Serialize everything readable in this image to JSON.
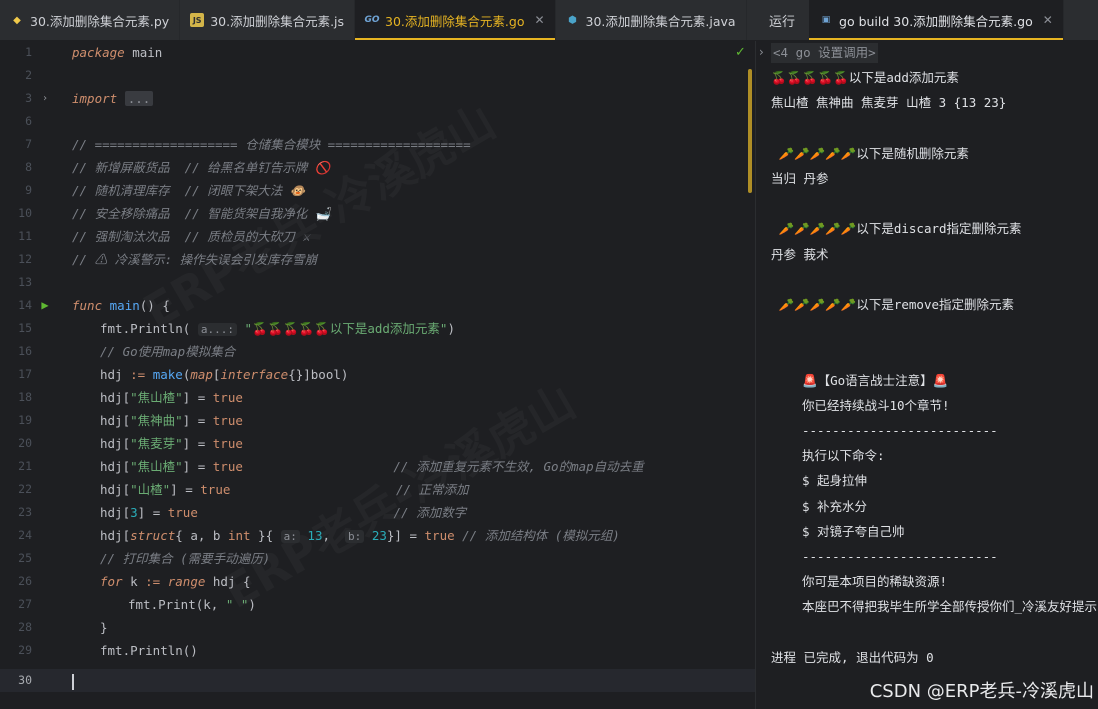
{
  "editor_tabs": [
    {
      "label": "30.添加删除集合元素.py",
      "icon": "python-icon"
    },
    {
      "label": "30.添加删除集合元素.js",
      "icon": "js-icon"
    },
    {
      "label": "30.添加删除集合元素.go",
      "icon": "go-icon",
      "active": true
    },
    {
      "label": "30.添加删除集合元素.java",
      "icon": "java-icon"
    }
  ],
  "more_label": "⋮",
  "run_panel": {
    "title": "运行",
    "tab_label": "go build 30.添加删除集合元素.go"
  },
  "code": {
    "l1_kw": "package",
    "l1_rest": " main",
    "l3_kw": "import",
    "l3_fold": "...",
    "l7": "// =================== 仓储集合模块 ===================",
    "l8": "// 新增屏蔽货品  // 给黑名单钉告示牌 🚫",
    "l9": "// 随机清理库存  // 闭眼下架大法 🐵",
    "l10": "// 安全移除痛品  // 智能货架自我净化 🛁",
    "l11": "// 强制淘汰次品  // 质检员的大砍刀 ⚔",
    "l12": "// ⚠ 冷溪警示: 操作失误会引发库存雪崩",
    "l14_kw": "func",
    "l14_fn": "main",
    "l14_rest": "() {",
    "l15_a": "fmt.Println( ",
    "l15_hint": "a...:",
    "l15_str": "\"🍒🍒🍒🍒🍒以下是add添加元素\"",
    "l15_end": ")",
    "l16": "// Go使用map模拟集合",
    "l17_a": "hdj ",
    "l17_op": ":=",
    "l17_fn": " make",
    "l17_p": "(",
    "l17_kw": "map",
    "l17_b": "[",
    "l17_kw2": "interface",
    "l17_c": "{}]",
    "l17_t": "bool",
    "l17_d": ")",
    "l18_a": "hdj[",
    "l18_s": "\"焦山楂\"",
    "l18_b": "] = ",
    "l18_v": "true",
    "l19_a": "hdj[",
    "l19_s": "\"焦神曲\"",
    "l19_b": "] = ",
    "l19_v": "true",
    "l20_a": "hdj[",
    "l20_s": "\"焦麦芽\"",
    "l20_b": "] = ",
    "l20_v": "true",
    "l21_a": "hdj[",
    "l21_s": "\"焦山楂\"",
    "l21_b": "] = ",
    "l21_v": "true",
    "l21_c": "                    // 添加重复元素不生效, Go的map自动去重",
    "l22_a": "hdj[",
    "l22_s": "\"山楂\"",
    "l22_b": "] = ",
    "l22_v": "true",
    "l22_c": "                      // 正常添加",
    "l23_a": "hdj[",
    "l23_n": "3",
    "l23_b": "] = ",
    "l23_v": "true",
    "l23_c": "                          // 添加数字",
    "l24_a": "hdj[",
    "l24_kw": "struct",
    "l24_b": "{ a, b ",
    "l24_t": "int",
    "l24_c": " }{ ",
    "l24_h1": "a:",
    "l24_n1": " 13",
    "l24_d": ",  ",
    "l24_h2": "b:",
    "l24_n2": " 23",
    "l24_e": "}] = ",
    "l24_v": "true",
    "l24_cm": " // 添加结构体 (模拟元组)",
    "l25": "// 打印集合 (需要手动遍历)",
    "l26_kw": "for",
    "l26_a": " k ",
    "l26_op": ":=",
    "l26_kw2": " range",
    "l26_b": " hdj {",
    "l27_a": "fmt.Print(k, ",
    "l27_s": "\" \"",
    "l27_b": ")",
    "l28": "}",
    "l29": "fmt.Println()"
  },
  "console_lines": {
    "head": "<4 go 设置调用>",
    "c1": "🍒🍒🍒🍒🍒以下是add添加元素",
    "c2": "焦山楂 焦神曲 焦麦芽 山楂 3 {13 23}",
    "c3": " 🥕🥕🥕🥕🥕以下是随机删除元素",
    "c4": "当归 丹参",
    "c5": " 🥕🥕🥕🥕🥕以下是discard指定删除元素",
    "c6": "丹参 莪术",
    "c7": " 🥕🥕🥕🥕🥕以下是remove指定删除元素",
    "c8": "🚨【Go语言战士注意】🚨",
    "c9": "你已经持续战斗10个章节!",
    "c10": "--------------------------",
    "c11": "执行以下命令:",
    "c12": "$ 起身拉伸",
    "c13": "$ 补充水分",
    "c14": "$ 对镜子夸自己帅",
    "c15": "--------------------------",
    "c16": "你可是本项目的稀缺资源!",
    "c17": "本座巴不得把我毕生所学全部传授你们_冷溪友好提示",
    "c18": "进程 已完成, 退出代码为 0"
  },
  "watermark": "CSDN @ERP老兵-冷溪虎山",
  "bg_watermark": "ERP老兵-冷溪虎山"
}
